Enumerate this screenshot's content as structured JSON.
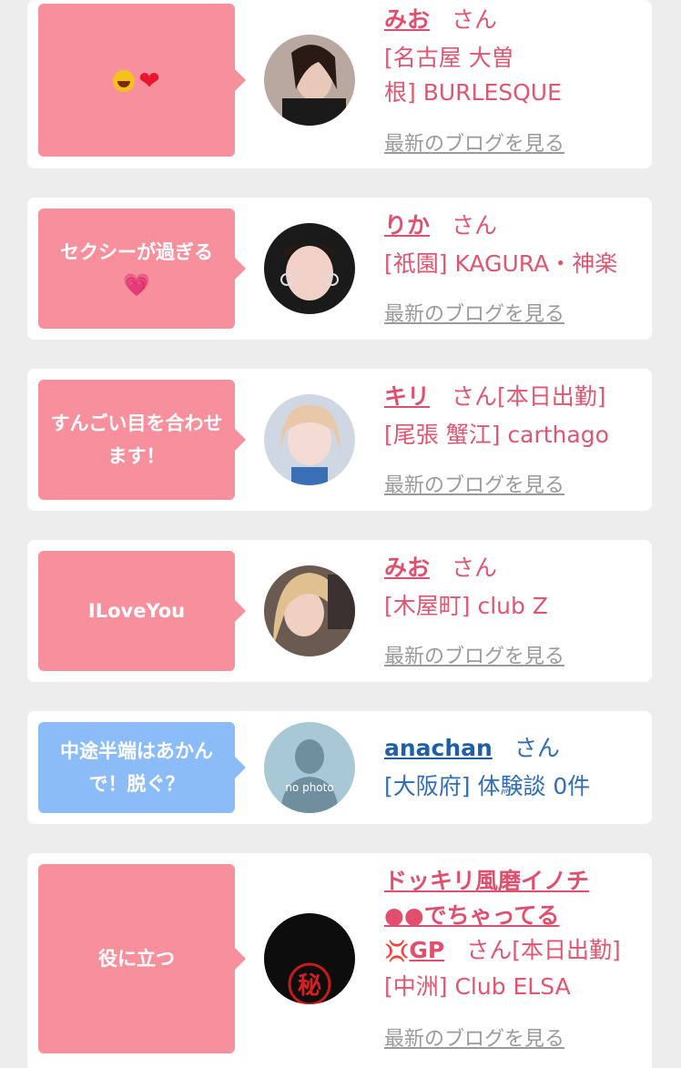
{
  "link_label": "最新のブログを見る",
  "san": "さん",
  "entries": [
    {
      "comment": "",
      "comment_icons": [
        "laugh-icon",
        "heart-icon"
      ],
      "name": "みお",
      "status": "",
      "info_lines": [
        "[名古屋 大曽",
        "根] BURLESQUE"
      ],
      "has_blog_link": true,
      "bubble_color": "#f7909c",
      "avatar_label": ""
    },
    {
      "comment": "セクシーが過ぎる",
      "comment_icons": [
        "sparkle-heart-icon"
      ],
      "name": "りか",
      "status": "",
      "info_lines": [
        "[祇園] KAGURA・神楽"
      ],
      "has_blog_link": true,
      "bubble_color": "#f7909c",
      "avatar_label": ""
    },
    {
      "comment": "すんごい目を合わせます！",
      "comment_icons": [],
      "name": "キリ",
      "status": "[本日出勤]",
      "info_lines": [
        "[尾張 蟹江] carthago"
      ],
      "has_blog_link": true,
      "bubble_color": "#f7909c",
      "avatar_label": ""
    },
    {
      "comment": "ILoveYou",
      "comment_icons": [],
      "name": "みお",
      "status": "",
      "info_lines": [
        "[木屋町] club Z"
      ],
      "has_blog_link": true,
      "bubble_color": "#f7909c",
      "avatar_label": ""
    },
    {
      "comment": "中途半端はあかんで！脱ぐ？",
      "comment_icons": [],
      "name": "anachan",
      "status": "",
      "info_lines": [
        "[大阪府] 体験談 0件"
      ],
      "has_blog_link": false,
      "bubble_color": "#8bbcf7",
      "avatar_label": "no photo"
    },
    {
      "comment": "役に立つ",
      "comment_icons": [],
      "name_lines": [
        "ドッキリ風磨イノチ",
        "●●でちゃってる"
      ],
      "name_tail": "GP",
      "status": "[本日出勤]",
      "info_lines": [
        "[中洲] Club ELSA"
      ],
      "has_blog_link": true,
      "bubble_color": "#f7909c",
      "avatar_label": "秘"
    }
  ]
}
